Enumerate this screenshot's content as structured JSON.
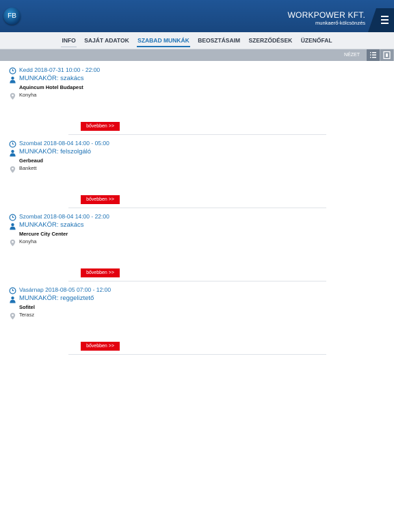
{
  "header": {
    "avatar_initials": "FB",
    "company_name": "WORKPOWER KFT.",
    "company_sub": "munkaerő-kölcsönzés"
  },
  "tabs": [
    {
      "label": "INFO"
    },
    {
      "label": "SAJÁT ADATOK"
    },
    {
      "label": "SZABAD MUNKÁK"
    },
    {
      "label": "BEOSZTÁSAIM"
    },
    {
      "label": "SZERZŐDÉSEK"
    },
    {
      "label": "ÜZENŐFAL"
    }
  ],
  "view_label": "NÉZET",
  "jobs": [
    {
      "date": "Kedd 2018-07-31 10:00 - 22:00",
      "role": "MUNKAKÖR: szakács",
      "place": "Aquincum Hotel Budapest",
      "dept": "Konyha",
      "more": "bővebben >>"
    },
    {
      "date": "Szombat 2018-08-04 14:00 - 05:00",
      "role": "MUNKAKÖR: felszolgáló",
      "place": "Gerbeaud",
      "dept": "Bankett",
      "more": "bővebben >>"
    },
    {
      "date": "Szombat 2018-08-04 14:00 - 22:00",
      "role": "MUNKAKÖR: szakács",
      "place": "Mercure City Center",
      "dept": "Konyha",
      "more": "bővebben >>"
    },
    {
      "date": "Vasárnap 2018-08-05 07:00 - 12:00",
      "role": "MUNKAKÖR: reggeliztető",
      "place": "Sofitel",
      "dept": "Terasz",
      "more": "bővebben >>"
    }
  ],
  "colors": {
    "header": "#1f5596",
    "accent": "#1f73b5",
    "button": "#e3000f"
  }
}
